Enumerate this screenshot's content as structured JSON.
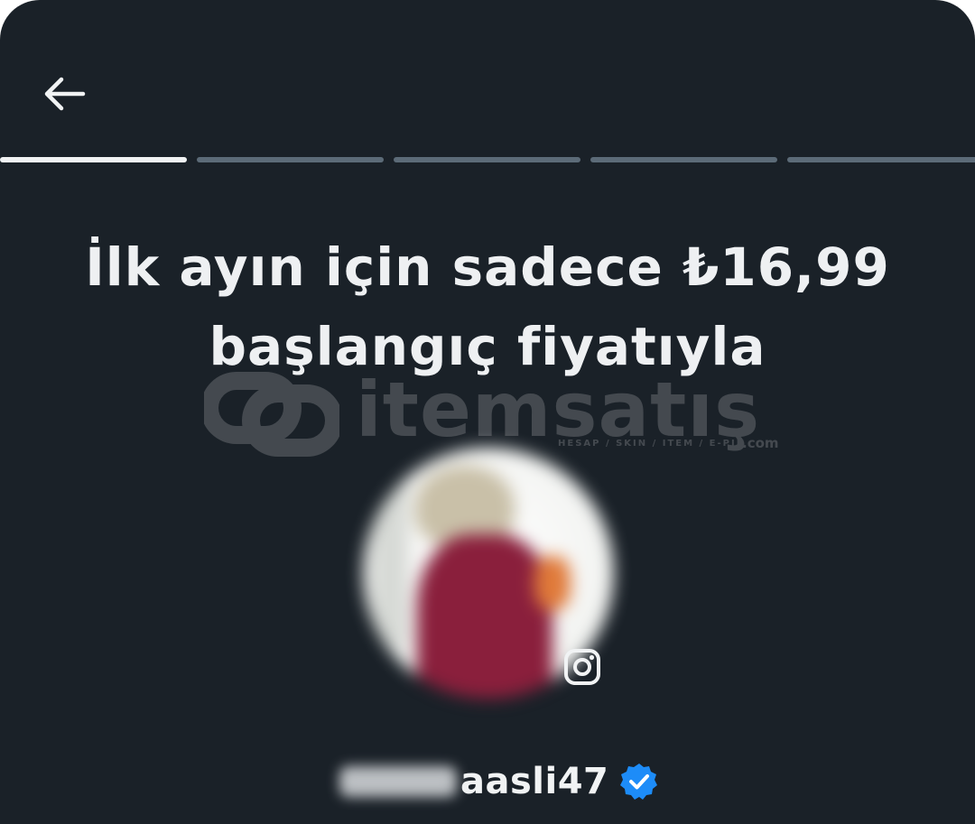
{
  "header": {
    "back_icon": "arrow-left-icon"
  },
  "progress": {
    "total_steps": 5,
    "current_step": 1
  },
  "headline": {
    "line1": "İlk ayın için sadece ₺16,99",
    "line2": "başlangıç fiyatıyla"
  },
  "watermark": {
    "brand": "itemsatış",
    "tagline": "HESAP / SKIN / ITEM / E-PIN",
    "suffix": ".com"
  },
  "profile": {
    "username_visible": "aasli47",
    "verified_icon": "verified-badge-icon",
    "platform_icon": "instagram-icon",
    "avatar": "profile-avatar-blurred"
  },
  "colors": {
    "background": "#1a2128",
    "text": "#eef0f2",
    "progress_active": "#f1f3f4",
    "progress_inactive": "#5c6b78",
    "verified": "#1d8cf8"
  }
}
